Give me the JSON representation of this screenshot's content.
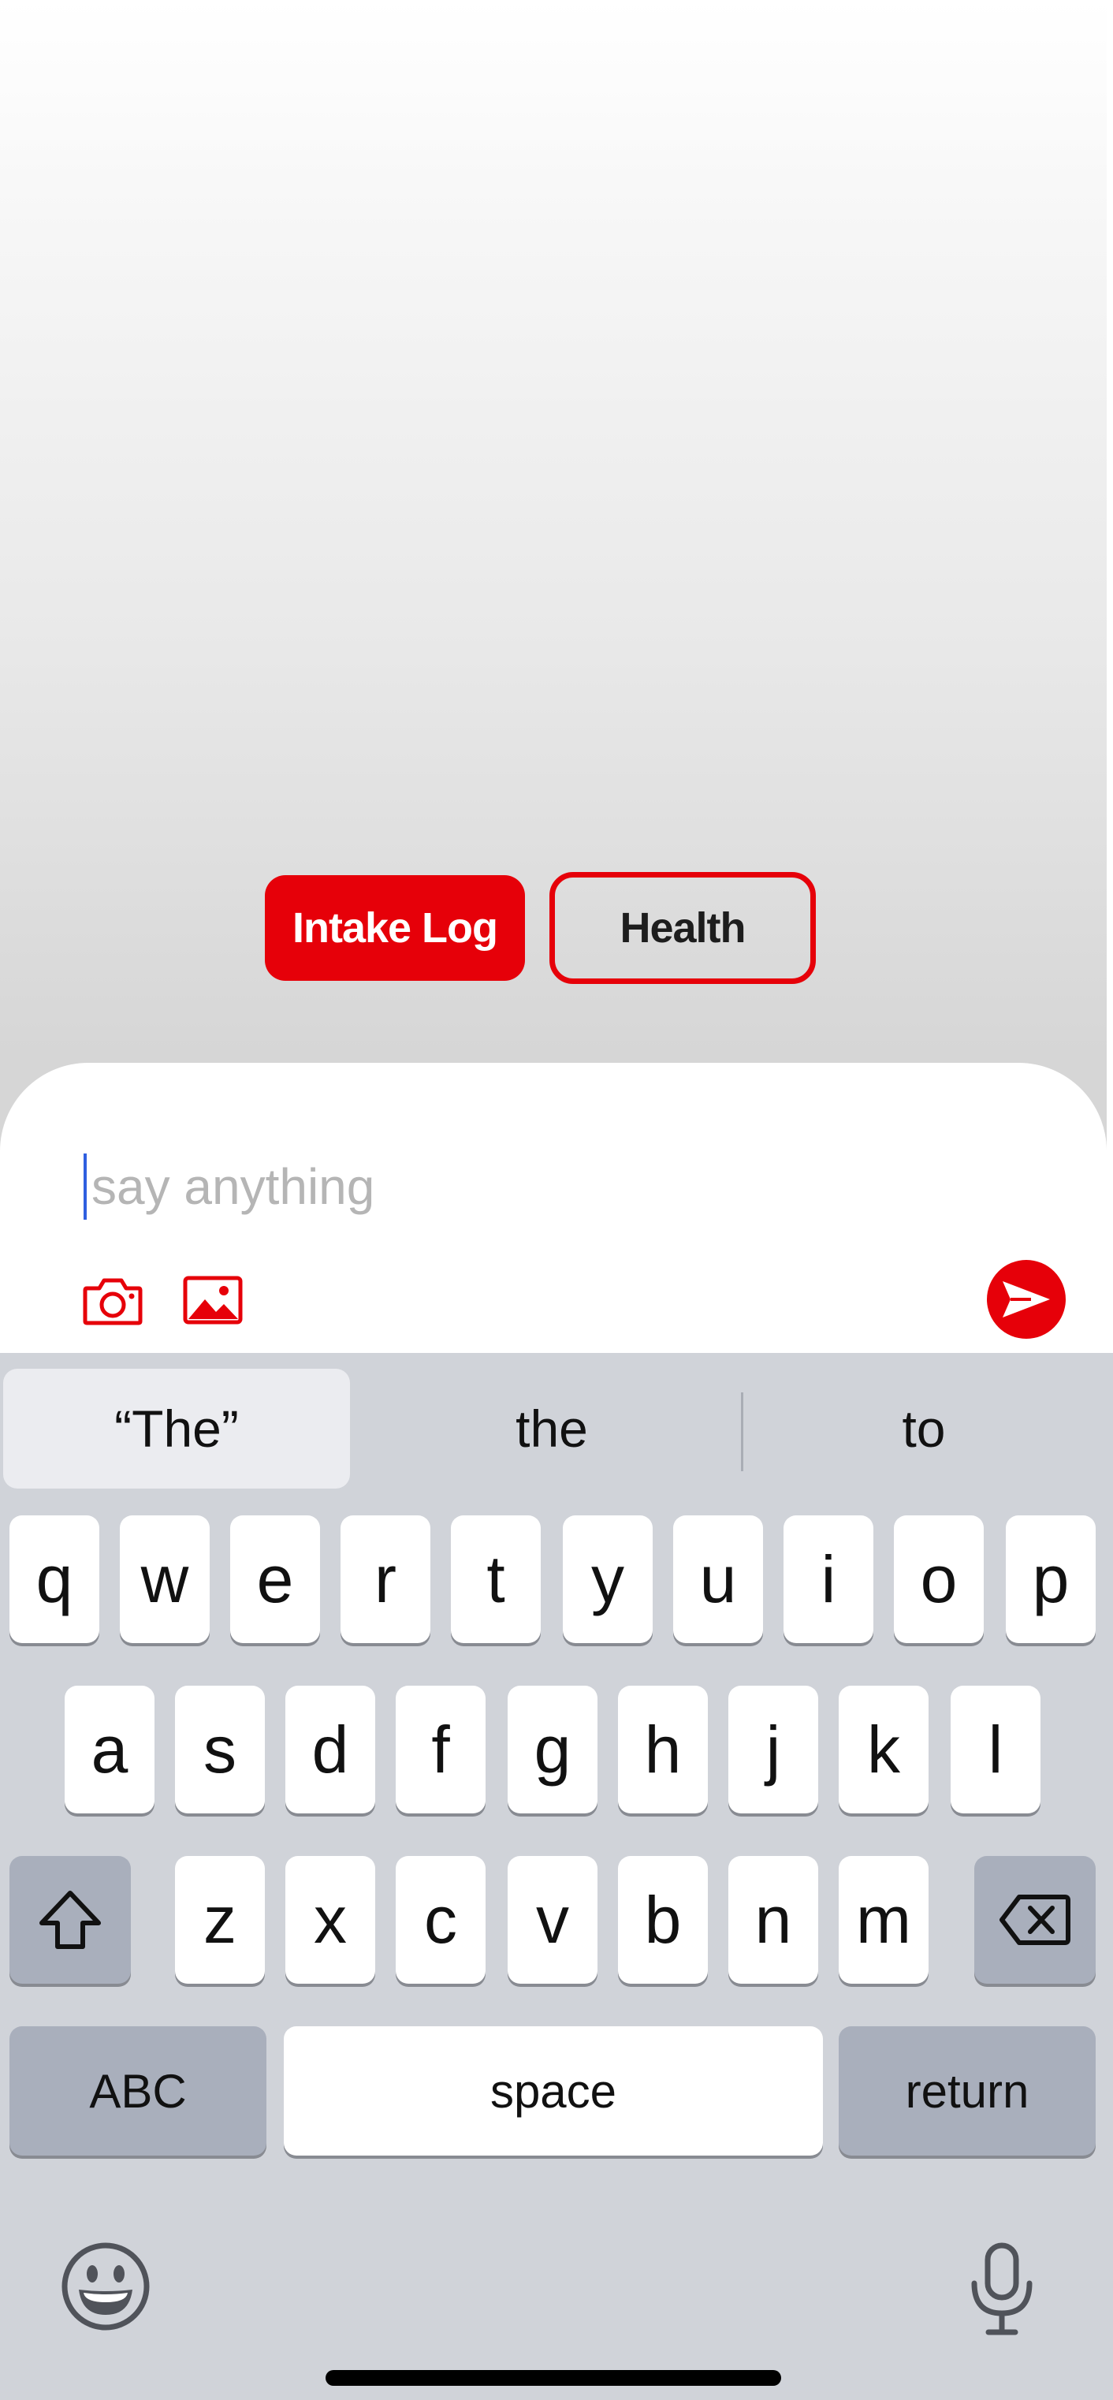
{
  "quick_actions": {
    "intake_log_label": "Intake Log",
    "health_label": "Health"
  },
  "composer": {
    "placeholder": "say anything",
    "camera_icon": "camera-icon",
    "gallery_icon": "image-gallery-icon",
    "send_icon": "send-arrow-icon"
  },
  "keyboard": {
    "suggestions": [
      "“The”",
      "the",
      "to"
    ],
    "row1": [
      "q",
      "w",
      "e",
      "r",
      "t",
      "y",
      "u",
      "i",
      "o",
      "p"
    ],
    "row2": [
      "a",
      "s",
      "d",
      "f",
      "g",
      "h",
      "j",
      "k",
      "l"
    ],
    "row3": [
      "z",
      "x",
      "c",
      "v",
      "b",
      "n",
      "m"
    ],
    "abc_label": "ABC",
    "space_label": "space",
    "return_label": "return",
    "shift_icon": "shift-icon",
    "delete_icon": "backspace-icon",
    "emoji_icon": "emoji-icon",
    "mic_icon": "microphone-icon"
  },
  "colors": {
    "accent": "#e60009",
    "keyboard_bg": "#d0d3d9"
  }
}
